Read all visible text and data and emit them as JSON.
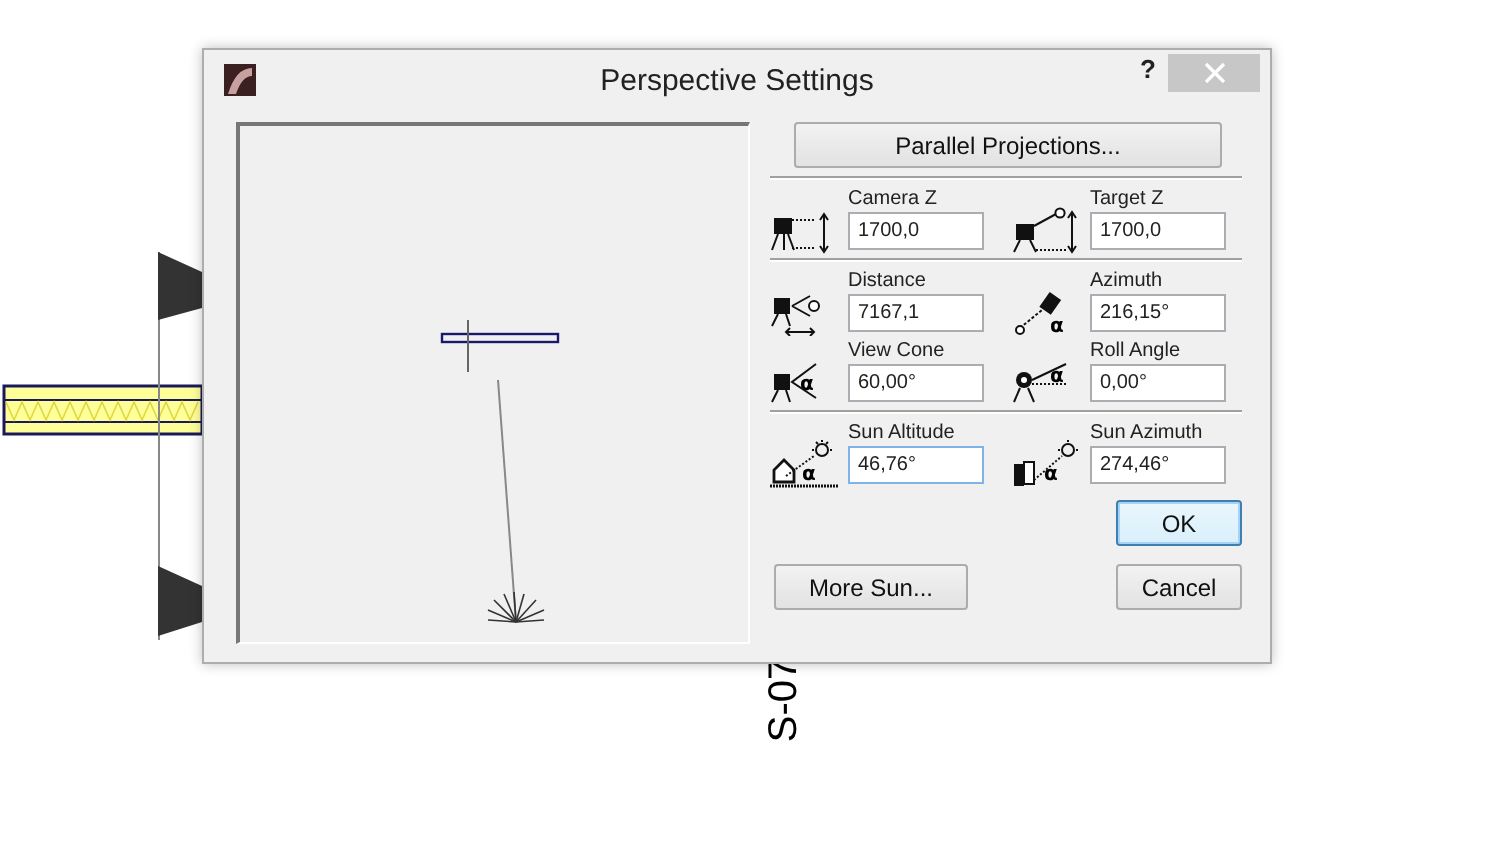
{
  "canvas": {
    "label": "S-07"
  },
  "dialog": {
    "title": "Perspective Settings",
    "help": "?",
    "parallel_button": "Parallel Projections...",
    "rows": [
      {
        "separator": true,
        "fields": [
          {
            "label": "Camera Z",
            "value": "1700,0",
            "kind": "camera-height",
            "focused": false
          },
          {
            "label": "Target Z",
            "value": "1700,0",
            "kind": "target-height",
            "focused": false
          }
        ]
      },
      {
        "separator": false,
        "fields": [
          {
            "label": "Distance",
            "value": "7167,1",
            "kind": "distance",
            "focused": false
          },
          {
            "label": "Azimuth",
            "value": "216,15°",
            "kind": "azimuth",
            "symbol": "α",
            "focused": false
          }
        ]
      },
      {
        "separator": true,
        "fields": [
          {
            "label": "View Cone",
            "value": "60,00°",
            "kind": "view-cone",
            "symbol": "α",
            "focused": false
          },
          {
            "label": "Roll Angle",
            "value": "0,00°",
            "kind": "roll",
            "symbol": "α",
            "focused": false
          }
        ]
      },
      {
        "separator": false,
        "fields": [
          {
            "label": "Sun Altitude",
            "value": "46,76°",
            "kind": "sun-altitude",
            "symbol": "α",
            "focused": true
          },
          {
            "label": "Sun Azimuth",
            "value": "274,46°",
            "kind": "sun-azimuth",
            "symbol": "α",
            "focused": false
          }
        ]
      }
    ],
    "ok_button": {
      "label": "OK",
      "default": true
    },
    "more_sun_button": "More Sun...",
    "cancel_button": "Cancel"
  }
}
